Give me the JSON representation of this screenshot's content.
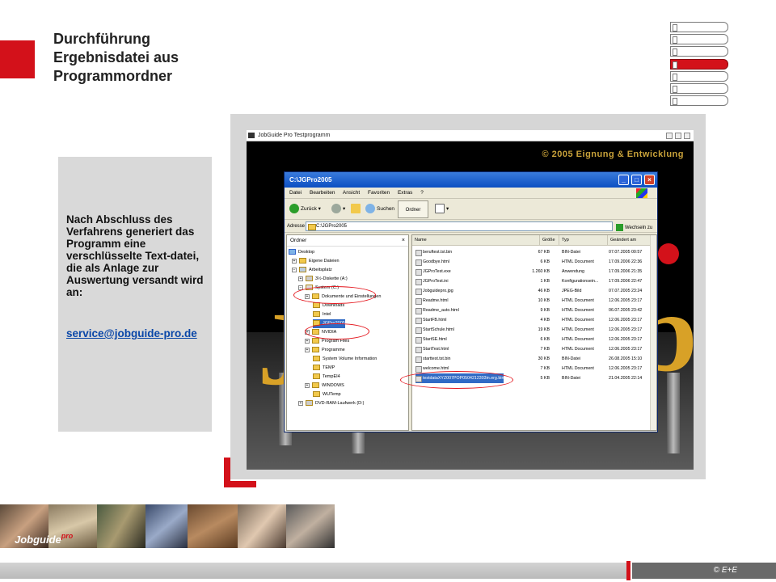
{
  "slide": {
    "title_lines": [
      "Durchführung",
      "Ergebnisdatei aus",
      "Programmordner"
    ],
    "info_text": "Nach Abschluss des Verfahrens generiert das Programm eine verschlüsselte Text-datei, die als Anlage zur Auswertung versandt wird an:",
    "info_email": "service@jobguide-pro.de",
    "copyright": "© E+E",
    "accent_color": "#d3111a",
    "nav_tabs_active_index": 3,
    "logo_text": "Jobguide",
    "logo_suffix": "pro"
  },
  "app": {
    "title": "JobGuide Pro Testprogramm",
    "brand": "© 2005 Eignung & Entwicklung"
  },
  "explorer": {
    "title": "C:\\JGPro2005",
    "menu": [
      "Datei",
      "Bearbeiten",
      "Ansicht",
      "Favoriten",
      "Extras",
      "?"
    ],
    "toolbar": {
      "back": "Zurück",
      "search": "Suchen",
      "folders": "Ordner"
    },
    "address_label": "Adresse",
    "address_value": "C:\\JGPro2005",
    "go_label": "Wechseln zu",
    "folders_pane_title": "Ordner",
    "tree": [
      "Desktop",
      "Eigene Dateien",
      "Arbeitsplatz",
      "3½-Diskette (A:)",
      "System (C:)",
      "Dokumente und Einstellungen",
      "Downloads",
      "Intel",
      "JGPro2005",
      "NVIDIA",
      "Program Files",
      "Programme",
      "System Volume Information",
      "TEMP",
      "TempEI4",
      "WINDOWS",
      "WUTemp",
      "DVD-RAM-Laufwerk (D:)"
    ],
    "columns": [
      "Name",
      "Größe",
      "Typ",
      "Geändert am"
    ],
    "files": [
      {
        "name": "beruftest.tst.bin",
        "size": "67 KB",
        "type": "BIN-Datei",
        "date": "07.07.2005 00:57"
      },
      {
        "name": "Goodbye.html",
        "size": "6 KB",
        "type": "HTML Document",
        "date": "17.09.2006 22:36"
      },
      {
        "name": "JGProTest.exe",
        "size": "1.260 KB",
        "type": "Anwendung",
        "date": "17.09.2006 21:35"
      },
      {
        "name": "JGProTest.ini",
        "size": "1 KB",
        "type": "Konfigurationsein...",
        "date": "17.09.2006 22:47"
      },
      {
        "name": "Jobguidepro.jpg",
        "size": "46 KB",
        "type": "JPEG-Bild",
        "date": "07.07.2005 23:24"
      },
      {
        "name": "Readme.html",
        "size": "10 KB",
        "type": "HTML Document",
        "date": "12.06.2005 23:17"
      },
      {
        "name": "Readme_auto.html",
        "size": "9 KB",
        "type": "HTML Document",
        "date": "06.07.2005 23:42"
      },
      {
        "name": "StartFB.html",
        "size": "4 KB",
        "type": "HTML Document",
        "date": "12.06.2005 23:17"
      },
      {
        "name": "StartSchule.html",
        "size": "19 KB",
        "type": "HTML Document",
        "date": "12.06.2005 23:17"
      },
      {
        "name": "StartSE.html",
        "size": "6 KB",
        "type": "HTML Document",
        "date": "12.06.2005 23:17"
      },
      {
        "name": "StartTest.html",
        "size": "7 KB",
        "type": "HTML Document",
        "date": "12.06.2005 23:17"
      },
      {
        "name": "starttest.tst.bin",
        "size": "30 KB",
        "type": "BIN-Datei",
        "date": "26.08.2005 15:10"
      },
      {
        "name": "welcome.html",
        "size": "7 KB",
        "type": "HTML Document",
        "date": "12.06.2005 23:17"
      },
      {
        "name": "testdataXYZ007POP0504212303in.erg.bin",
        "size": "5 KB",
        "type": "BIN-Datei",
        "date": "21.04.2005 22:14"
      }
    ],
    "selected_file_index": 13,
    "selected_folder_index": 8
  }
}
